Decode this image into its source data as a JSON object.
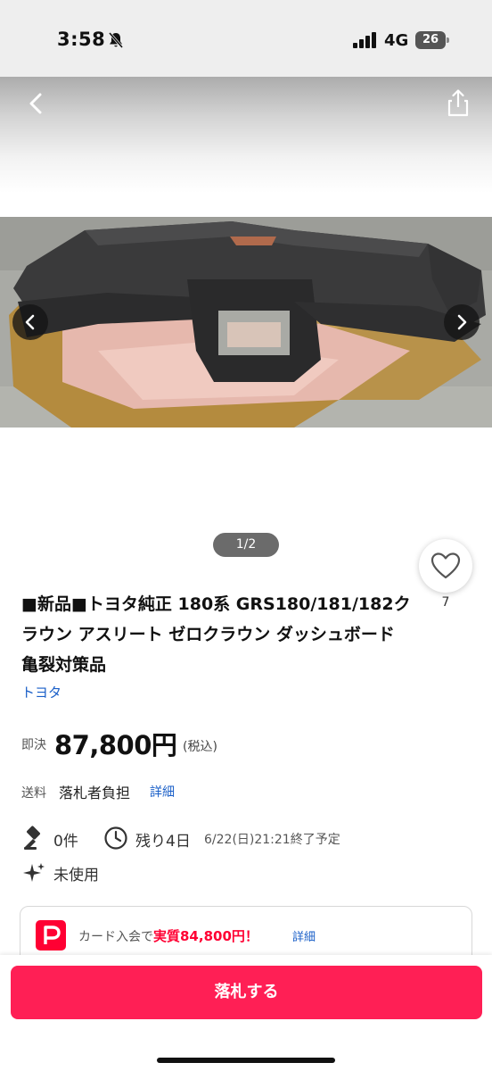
{
  "status_bar": {
    "time": "3:58",
    "network": "4G",
    "battery": "26",
    "icons": [
      "bell-slash-icon",
      "cellular-signal-icon",
      "battery-icon"
    ]
  },
  "gallery": {
    "page_indicator": "1/2",
    "icons": [
      "chevron-left-icon",
      "share-icon",
      "chevron-left-icon",
      "chevron-right-icon"
    ]
  },
  "like": {
    "count": "7",
    "icon": "heart-icon"
  },
  "product": {
    "title": "■新品■トヨタ純正 180系 GRS180/181/182クラウン アスリート ゼロクラウン ダッシュボード　亀裂対策品",
    "brand": "トヨタ"
  },
  "price": {
    "label": "即決",
    "value": "87,800円",
    "tax": "(税込)"
  },
  "shipping": {
    "label": "送料",
    "value": "落札者負担",
    "detail_link": "詳細"
  },
  "auction": {
    "bids": "0件",
    "remaining": "残り4日",
    "end_time": "6/22(日)21:21終了予定",
    "icons": [
      "gavel-icon",
      "clock-icon",
      "sparkle-icon"
    ]
  },
  "condition": "未使用",
  "promo": {
    "prefix": "カード入会で",
    "highlight": "実質84,800円！",
    "detail_link": "詳細",
    "icon": "paypay-icon"
  },
  "action": {
    "bid_button": "落札する"
  },
  "colors": {
    "accent": "#ff1f55",
    "link": "#1a5fc8",
    "promo_red": "#ff0033"
  }
}
